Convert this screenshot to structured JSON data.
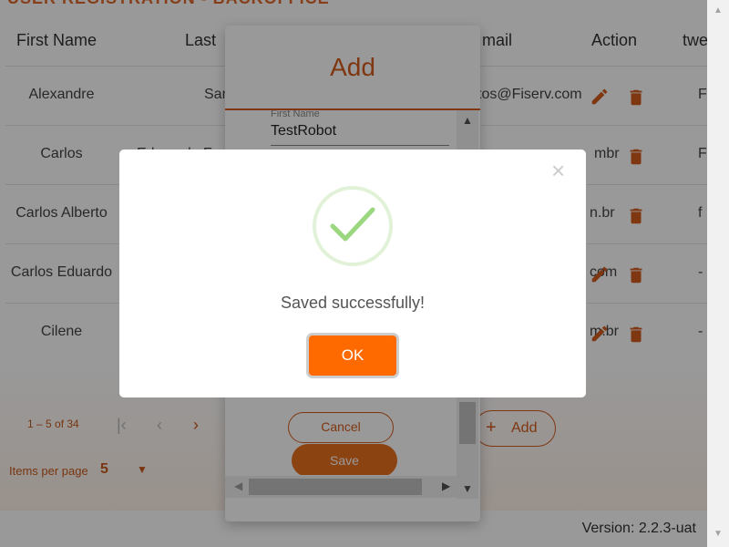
{
  "page": {
    "title": "USER REGISTRATION - BACKOFFICE",
    "columns": [
      "First Name",
      "Last",
      "mail",
      "Action",
      "twe"
    ],
    "rows": [
      {
        "first_name": "Alexandre",
        "last": "San",
        "email": "tos@Fiserv.com",
        "extra": "F"
      },
      {
        "first_name": "Carlos",
        "last": "Edmundo Fr",
        "email": "mbr",
        "extra": "F"
      },
      {
        "first_name": "Carlos Alberto",
        "last": "",
        "email": "n.br",
        "extra": "f"
      },
      {
        "first_name": "Carlos Eduardo",
        "last": "",
        "email": "com",
        "extra": "-"
      },
      {
        "first_name": "Cilene",
        "last": "",
        "email": "m.br",
        "extra": "-"
      }
    ],
    "paginator": {
      "range": "1 – 5 of 34",
      "items_per_page_label": "Items per page",
      "items_per_page_value": "5"
    },
    "add_button_label": "Add",
    "version": "Version: 2.2.3-uat"
  },
  "add_dialog": {
    "title": "Add",
    "first_name_label": "First Name",
    "first_name_value": "TestRobot",
    "cancel_label": "Cancel",
    "save_label": "Save"
  },
  "alert": {
    "message": "Saved successfully!",
    "ok_label": "OK",
    "close_symbol": "×",
    "icon": "success-check-icon"
  },
  "colors": {
    "brand_orange": "#d45c1d",
    "ok_orange": "#ff6a00",
    "success_green": "#9ad77f"
  }
}
